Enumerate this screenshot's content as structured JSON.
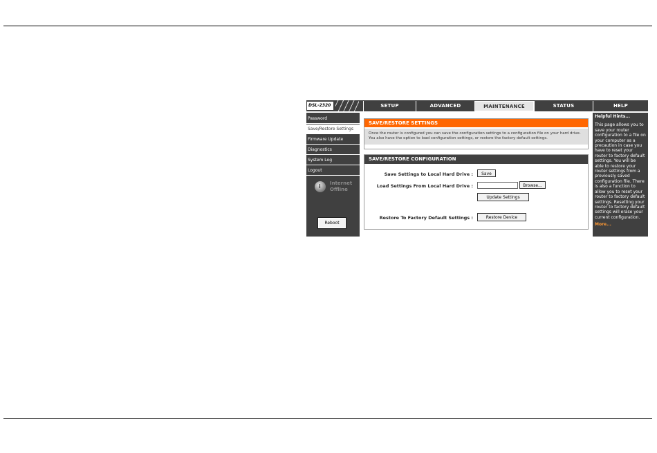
{
  "nav": {
    "logo": "DSL-2320",
    "tabs": [
      "SETUP",
      "ADVANCED",
      "MAINTENANCE",
      "STATUS",
      "HELP"
    ],
    "active_tab": "MAINTENANCE"
  },
  "sidebar": {
    "items": [
      "Password",
      "Save/Restore Settings",
      "Firmware Update",
      "Diagnostics",
      "System Log",
      "Logout"
    ],
    "active_item": "Save/Restore Settings",
    "status_line1": "Internet",
    "status_line2": "Offline",
    "status_icon": "internet-status-icon",
    "reboot_label": "Reboot"
  },
  "intro": {
    "title": "SAVE/RESTORE SETTINGS",
    "text": "Once the router is configured you can save the configuration settings to a configuration file on your hard drive. You also have the option to load configuration settings, or restore the factory default settings."
  },
  "config": {
    "title": "SAVE/RESTORE CONFIGURATION",
    "save_label": "Save Settings to Local Hard Drive :",
    "save_button": "Save",
    "load_label": "Load Settings From Local Hard Drive :",
    "browse_button": "Browse...",
    "update_button": "Update Settings",
    "restore_label": "Restore To Factory Default Settings :",
    "restore_button": "Restore Device"
  },
  "hints": {
    "title": "Helpful Hints...",
    "text": "This page allows you to save your router configuration to a file on your computer as a precaution in case you have to reset your router to factory default settings. You will be able to restore your router settings from a previously saved configuration file. There is also a function to allow you to reset your router to factory default settings. Resetting your router to factory default settings will erase your current configuration.",
    "more": "More..."
  },
  "colors": {
    "nav_bg": "#404040",
    "accent_orange": "#ff6600"
  }
}
